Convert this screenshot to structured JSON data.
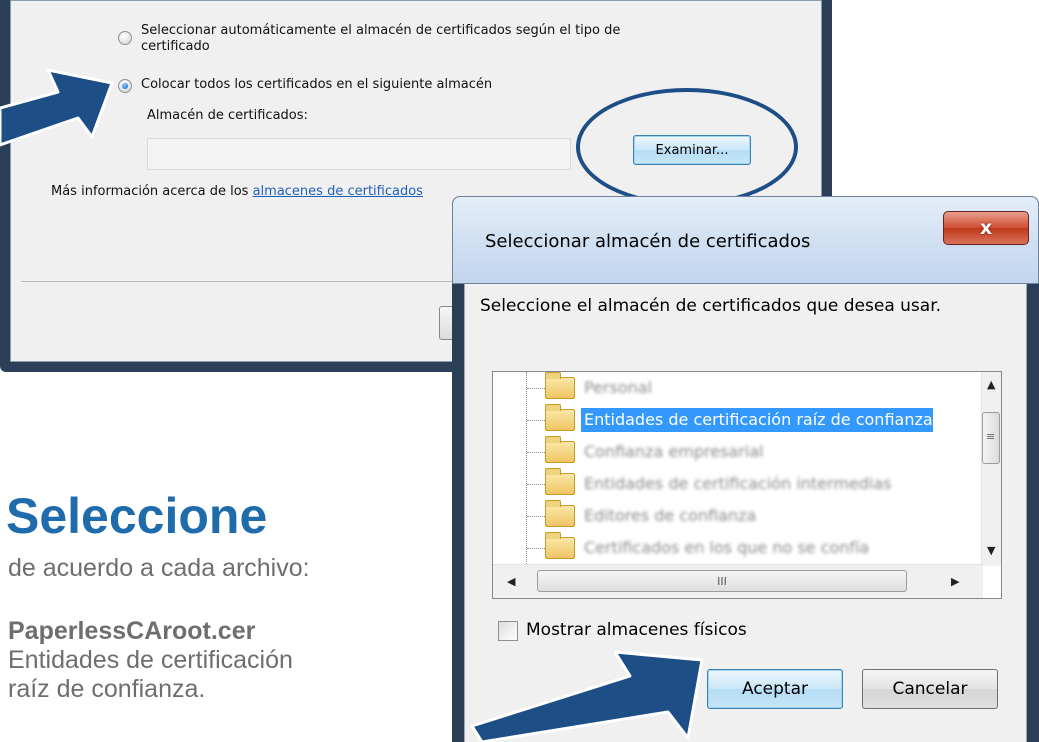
{
  "colors": {
    "accent_blue": "#1f6cac",
    "arrow_navy": "#1d4f86",
    "selection": "#3399ff",
    "caption_gray": "#6e6e6e",
    "close_red": "#c0391c"
  },
  "wizard": {
    "radio_auto_label_line1": "Seleccionar automáticamente el almacén de certificados según el tipo de",
    "radio_auto_label_line2": "certificado",
    "radio_auto_selected": false,
    "radio_place_label": "Colocar todos los certificados en el siguiente almacén",
    "radio_place_selected": true,
    "store_label": "Almacén de certificados:",
    "store_value": "",
    "browse_button": "Examinar...",
    "more_info_prefix": "Más información acerca de los ",
    "more_info_link": "almacenes de certificados"
  },
  "dialog": {
    "title": "Seleccionar almacén de certificados",
    "close_glyph": "x",
    "close_icon": "close-icon",
    "instruction": "Seleccione el almacén de certificados que desea usar.",
    "stores": [
      {
        "label": "Personal",
        "selected": false
      },
      {
        "label": "Entidades de certificación raíz de confianza",
        "selected": true
      },
      {
        "label": "Confianza empresarial",
        "selected": false
      },
      {
        "label": "Entidades de certificación intermedias",
        "selected": false
      },
      {
        "label": "Editores de confianza",
        "selected": false
      },
      {
        "label": "Certificados en los que no se confía",
        "selected": false
      }
    ],
    "scroll_up_glyph": "▲",
    "scroll_down_glyph": "▼",
    "scroll_left_glyph": "◀",
    "scroll_right_glyph": "▶",
    "vthumb_grip": "≡",
    "hthumb_grip": "III",
    "show_physical_label": "Mostrar almacenes físicos",
    "show_physical_checked": false,
    "ok_button": "Aceptar",
    "cancel_button": "Cancelar"
  },
  "caption": {
    "title": "Seleccione",
    "subtitle": "de acuerdo a cada archivo:",
    "file_name": "PaperlessCAroot.cer",
    "file_store": "Entidades de certificación raíz de confianza."
  }
}
